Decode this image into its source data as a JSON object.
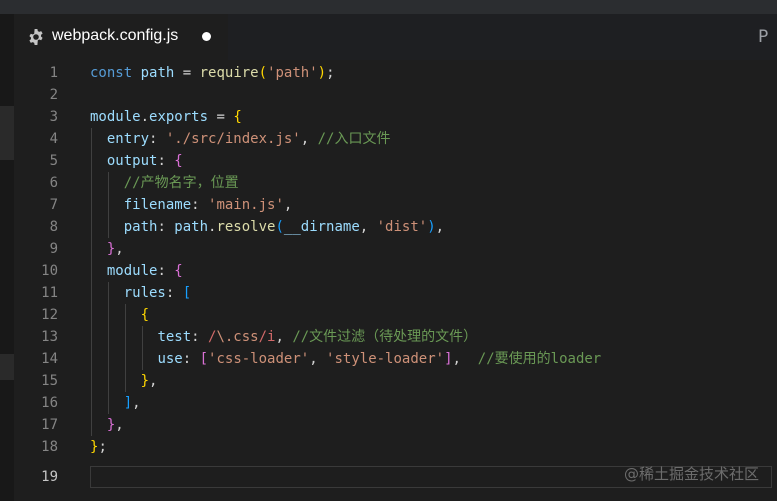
{
  "tab": {
    "filename": "webpack.config.js",
    "icon": "gear-icon",
    "modified": true
  },
  "split_icon": "P",
  "editor": {
    "lines": [
      {
        "n": "1"
      },
      {
        "n": "2"
      },
      {
        "n": "3"
      },
      {
        "n": "4"
      },
      {
        "n": "5"
      },
      {
        "n": "6"
      },
      {
        "n": "7"
      },
      {
        "n": "8"
      },
      {
        "n": "9"
      },
      {
        "n": "10"
      },
      {
        "n": "11"
      },
      {
        "n": "12"
      },
      {
        "n": "13"
      },
      {
        "n": "14"
      },
      {
        "n": "15"
      },
      {
        "n": "16"
      },
      {
        "n": "17"
      },
      {
        "n": "18"
      },
      {
        "n": "19"
      }
    ],
    "tokens": {
      "l1_const": "const",
      "l1_path": "path",
      "l1_eq": " = ",
      "l1_require": "require",
      "l1_p1": "(",
      "l1_str": "'path'",
      "l1_p2": ");",
      "l3_module": "module",
      "l3_dot": ".",
      "l3_exports": "exports",
      "l3_eq": " = ",
      "l3_brace": "{",
      "l4_entry": "entry",
      "l4_colon": ": ",
      "l4_str": "'./src/index.js'",
      "l4_comma": ", ",
      "l4_cmt": "//入口文件",
      "l5_output": "output",
      "l5_colon": ": ",
      "l5_brace": "{",
      "l6_cmt": "//产物名字，位置",
      "l7_filename": "filename",
      "l7_colon": ": ",
      "l7_str": "'main.js'",
      "l7_comma": ",",
      "l8_path": "path",
      "l8_colon": ": ",
      "l8_pathobj": "path",
      "l8_dot": ".",
      "l8_resolve": "resolve",
      "l8_p1": "(",
      "l8_dirname": "__dirname",
      "l8_comma": ", ",
      "l8_str": "'dist'",
      "l8_p2": ")",
      "l8_end": ",",
      "l9_close": "}",
      "l9_comma": ",",
      "l10_module": "module",
      "l10_colon": ": ",
      "l10_brace": "{",
      "l11_rules": "rules",
      "l11_colon": ": ",
      "l11_bracket": "[",
      "l12_brace": "{",
      "l13_test": "test",
      "l13_colon": ": ",
      "l13_rx1": "/",
      "l13_rx2": "\\.css",
      "l13_rx3": "/i",
      "l13_comma": ", ",
      "l13_cmt": "//文件过滤（待处理的文件）",
      "l14_use": "use",
      "l14_colon": ": ",
      "l14_b1": "[",
      "l14_s1": "'css-loader'",
      "l14_comma": ", ",
      "l14_s2": "'style-loader'",
      "l14_b2": "]",
      "l14_end": ",  ",
      "l14_cmt": "//要使用的loader",
      "l15_close": "}",
      "l15_comma": ",",
      "l16_close": "]",
      "l16_comma": ",",
      "l17_close": "}",
      "l17_comma": ",",
      "l18_close": "}",
      "l18_semi": ";"
    }
  },
  "watermark": "@稀土掘金技术社区"
}
